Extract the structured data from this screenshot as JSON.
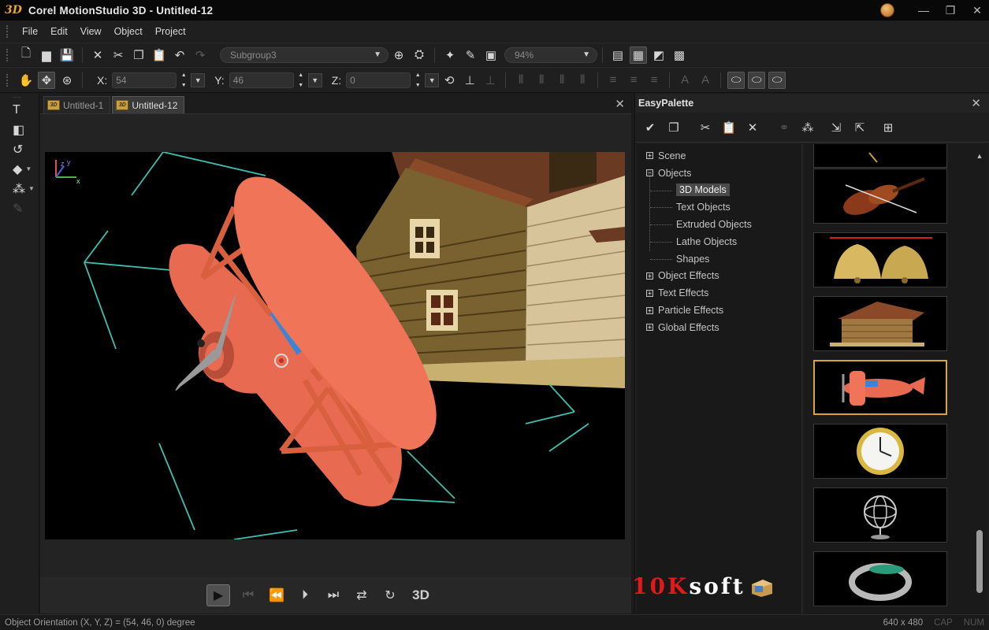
{
  "window": {
    "logo": "3D",
    "title": "Corel MotionStudio 3D - Untitled-12",
    "controls": [
      "—",
      "❐",
      "✕"
    ]
  },
  "menu": [
    "File",
    "Edit",
    "View",
    "Object",
    "Project"
  ],
  "toolbar1": {
    "group_select": "Subgroup3",
    "zoom": "94%"
  },
  "toolbar2": {
    "x_label": "X:",
    "x_value": "54",
    "y_label": "Y:",
    "y_value": "46",
    "z_label": "Z:",
    "z_value": "0"
  },
  "tabs": [
    {
      "icon": "3D",
      "label": "Untitled-1",
      "active": false
    },
    {
      "icon": "3D",
      "label": "Untitled-12",
      "active": true
    }
  ],
  "playback": {
    "mode_label": "3D"
  },
  "palette": {
    "title": "EasyPalette",
    "tree": [
      {
        "label": "Scene",
        "expander": "+",
        "level": 0
      },
      {
        "label": "Objects",
        "expander": "−",
        "level": 0
      },
      {
        "label": "3D Models",
        "level": 1,
        "selected": true
      },
      {
        "label": "Text Objects",
        "level": 1
      },
      {
        "label": "Extruded Objects",
        "level": 1
      },
      {
        "label": "Lathe Objects",
        "level": 1
      },
      {
        "label": "Shapes",
        "level": 1
      },
      {
        "label": "Object Effects",
        "expander": "+",
        "level": 0
      },
      {
        "label": "Text Effects",
        "expander": "+",
        "level": 0
      },
      {
        "label": "Particle Effects",
        "expander": "+",
        "level": 0
      },
      {
        "label": "Global Effects",
        "expander": "+",
        "level": 0
      }
    ],
    "thumbnails": [
      "guitar-thumbnail",
      "violin-thumbnail",
      "bells-thumbnail",
      "house-thumbnail",
      "airplane-thumbnail",
      "clock-thumbnail",
      "gyroscope-thumbnail",
      "ring-thumbnail"
    ],
    "selected_thumbnail": "airplane-thumbnail"
  },
  "status": {
    "text": "Object Orientation (X, Y, Z) = (54, 46, 0) degree",
    "resolution": "640 x 480",
    "caps": "CAP",
    "num": "NUM"
  },
  "watermark": {
    "part1": "10K",
    "part2": "soft"
  },
  "colors": {
    "plane": "#f07050",
    "bounding_box": "#3fbfb0",
    "accent_selection": "#d9a53a"
  }
}
